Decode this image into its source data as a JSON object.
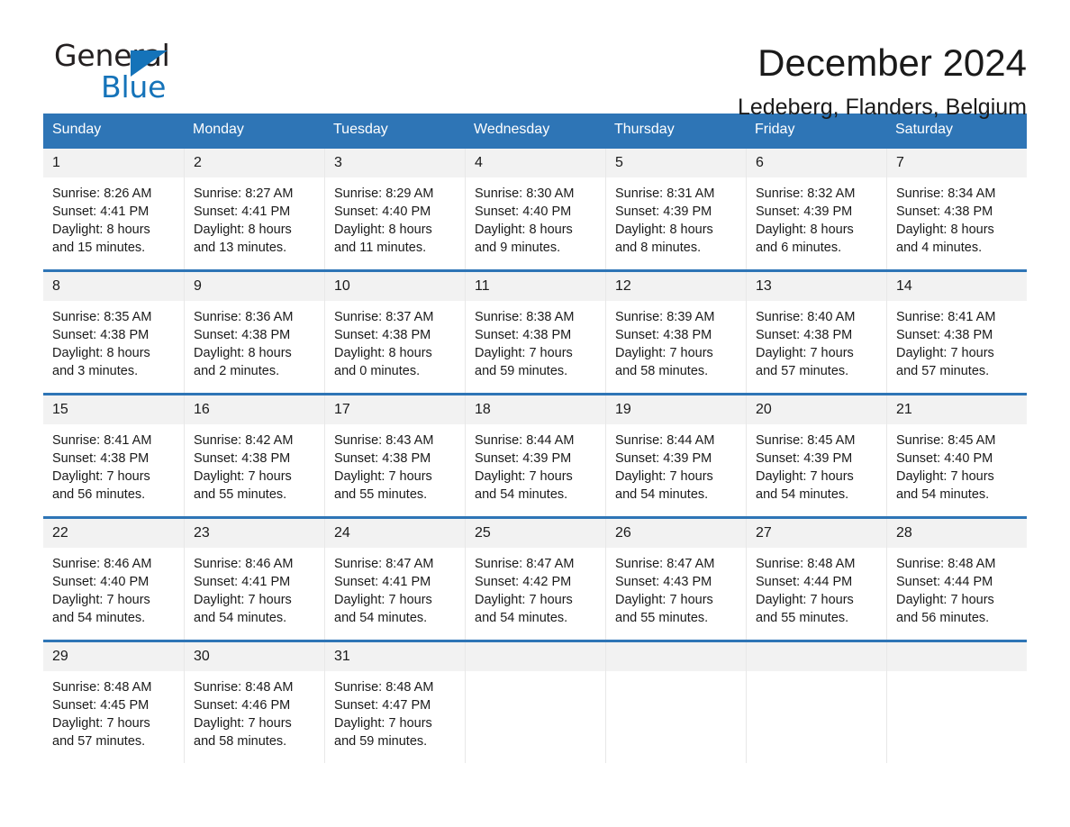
{
  "brand": {
    "name_top": "General",
    "name_bottom": "Blue",
    "accent_color": "#1573b9",
    "triangle_icon": "triangle-icon"
  },
  "header": {
    "title": "December 2024",
    "subtitle": "Ledeberg, Flanders, Belgium",
    "header_bg_color": "#2e75b6",
    "daynum_bg_color": "#f2f2f2"
  },
  "calendar": {
    "weekdays": [
      "Sunday",
      "Monday",
      "Tuesday",
      "Wednesday",
      "Thursday",
      "Friday",
      "Saturday"
    ],
    "weeks": [
      [
        {
          "day": "1",
          "sunrise": "Sunrise: 8:26 AM",
          "sunset": "Sunset: 4:41 PM",
          "daylight1": "Daylight: 8 hours",
          "daylight2": "and 15 minutes."
        },
        {
          "day": "2",
          "sunrise": "Sunrise: 8:27 AM",
          "sunset": "Sunset: 4:41 PM",
          "daylight1": "Daylight: 8 hours",
          "daylight2": "and 13 minutes."
        },
        {
          "day": "3",
          "sunrise": "Sunrise: 8:29 AM",
          "sunset": "Sunset: 4:40 PM",
          "daylight1": "Daylight: 8 hours",
          "daylight2": "and 11 minutes."
        },
        {
          "day": "4",
          "sunrise": "Sunrise: 8:30 AM",
          "sunset": "Sunset: 4:40 PM",
          "daylight1": "Daylight: 8 hours",
          "daylight2": "and 9 minutes."
        },
        {
          "day": "5",
          "sunrise": "Sunrise: 8:31 AM",
          "sunset": "Sunset: 4:39 PM",
          "daylight1": "Daylight: 8 hours",
          "daylight2": "and 8 minutes."
        },
        {
          "day": "6",
          "sunrise": "Sunrise: 8:32 AM",
          "sunset": "Sunset: 4:39 PM",
          "daylight1": "Daylight: 8 hours",
          "daylight2": "and 6 minutes."
        },
        {
          "day": "7",
          "sunrise": "Sunrise: 8:34 AM",
          "sunset": "Sunset: 4:38 PM",
          "daylight1": "Daylight: 8 hours",
          "daylight2": "and 4 minutes."
        }
      ],
      [
        {
          "day": "8",
          "sunrise": "Sunrise: 8:35 AM",
          "sunset": "Sunset: 4:38 PM",
          "daylight1": "Daylight: 8 hours",
          "daylight2": "and 3 minutes."
        },
        {
          "day": "9",
          "sunrise": "Sunrise: 8:36 AM",
          "sunset": "Sunset: 4:38 PM",
          "daylight1": "Daylight: 8 hours",
          "daylight2": "and 2 minutes."
        },
        {
          "day": "10",
          "sunrise": "Sunrise: 8:37 AM",
          "sunset": "Sunset: 4:38 PM",
          "daylight1": "Daylight: 8 hours",
          "daylight2": "and 0 minutes."
        },
        {
          "day": "11",
          "sunrise": "Sunrise: 8:38 AM",
          "sunset": "Sunset: 4:38 PM",
          "daylight1": "Daylight: 7 hours",
          "daylight2": "and 59 minutes."
        },
        {
          "day": "12",
          "sunrise": "Sunrise: 8:39 AM",
          "sunset": "Sunset: 4:38 PM",
          "daylight1": "Daylight: 7 hours",
          "daylight2": "and 58 minutes."
        },
        {
          "day": "13",
          "sunrise": "Sunrise: 8:40 AM",
          "sunset": "Sunset: 4:38 PM",
          "daylight1": "Daylight: 7 hours",
          "daylight2": "and 57 minutes."
        },
        {
          "day": "14",
          "sunrise": "Sunrise: 8:41 AM",
          "sunset": "Sunset: 4:38 PM",
          "daylight1": "Daylight: 7 hours",
          "daylight2": "and 57 minutes."
        }
      ],
      [
        {
          "day": "15",
          "sunrise": "Sunrise: 8:41 AM",
          "sunset": "Sunset: 4:38 PM",
          "daylight1": "Daylight: 7 hours",
          "daylight2": "and 56 minutes."
        },
        {
          "day": "16",
          "sunrise": "Sunrise: 8:42 AM",
          "sunset": "Sunset: 4:38 PM",
          "daylight1": "Daylight: 7 hours",
          "daylight2": "and 55 minutes."
        },
        {
          "day": "17",
          "sunrise": "Sunrise: 8:43 AM",
          "sunset": "Sunset: 4:38 PM",
          "daylight1": "Daylight: 7 hours",
          "daylight2": "and 55 minutes."
        },
        {
          "day": "18",
          "sunrise": "Sunrise: 8:44 AM",
          "sunset": "Sunset: 4:39 PM",
          "daylight1": "Daylight: 7 hours",
          "daylight2": "and 54 minutes."
        },
        {
          "day": "19",
          "sunrise": "Sunrise: 8:44 AM",
          "sunset": "Sunset: 4:39 PM",
          "daylight1": "Daylight: 7 hours",
          "daylight2": "and 54 minutes."
        },
        {
          "day": "20",
          "sunrise": "Sunrise: 8:45 AM",
          "sunset": "Sunset: 4:39 PM",
          "daylight1": "Daylight: 7 hours",
          "daylight2": "and 54 minutes."
        },
        {
          "day": "21",
          "sunrise": "Sunrise: 8:45 AM",
          "sunset": "Sunset: 4:40 PM",
          "daylight1": "Daylight: 7 hours",
          "daylight2": "and 54 minutes."
        }
      ],
      [
        {
          "day": "22",
          "sunrise": "Sunrise: 8:46 AM",
          "sunset": "Sunset: 4:40 PM",
          "daylight1": "Daylight: 7 hours",
          "daylight2": "and 54 minutes."
        },
        {
          "day": "23",
          "sunrise": "Sunrise: 8:46 AM",
          "sunset": "Sunset: 4:41 PM",
          "daylight1": "Daylight: 7 hours",
          "daylight2": "and 54 minutes."
        },
        {
          "day": "24",
          "sunrise": "Sunrise: 8:47 AM",
          "sunset": "Sunset: 4:41 PM",
          "daylight1": "Daylight: 7 hours",
          "daylight2": "and 54 minutes."
        },
        {
          "day": "25",
          "sunrise": "Sunrise: 8:47 AM",
          "sunset": "Sunset: 4:42 PM",
          "daylight1": "Daylight: 7 hours",
          "daylight2": "and 54 minutes."
        },
        {
          "day": "26",
          "sunrise": "Sunrise: 8:47 AM",
          "sunset": "Sunset: 4:43 PM",
          "daylight1": "Daylight: 7 hours",
          "daylight2": "and 55 minutes."
        },
        {
          "day": "27",
          "sunrise": "Sunrise: 8:48 AM",
          "sunset": "Sunset: 4:44 PM",
          "daylight1": "Daylight: 7 hours",
          "daylight2": "and 55 minutes."
        },
        {
          "day": "28",
          "sunrise": "Sunrise: 8:48 AM",
          "sunset": "Sunset: 4:44 PM",
          "daylight1": "Daylight: 7 hours",
          "daylight2": "and 56 minutes."
        }
      ],
      [
        {
          "day": "29",
          "sunrise": "Sunrise: 8:48 AM",
          "sunset": "Sunset: 4:45 PM",
          "daylight1": "Daylight: 7 hours",
          "daylight2": "and 57 minutes."
        },
        {
          "day": "30",
          "sunrise": "Sunrise: 8:48 AM",
          "sunset": "Sunset: 4:46 PM",
          "daylight1": "Daylight: 7 hours",
          "daylight2": "and 58 minutes."
        },
        {
          "day": "31",
          "sunrise": "Sunrise: 8:48 AM",
          "sunset": "Sunset: 4:47 PM",
          "daylight1": "Daylight: 7 hours",
          "daylight2": "and 59 minutes."
        },
        {
          "day": "",
          "sunrise": "",
          "sunset": "",
          "daylight1": "",
          "daylight2": ""
        },
        {
          "day": "",
          "sunrise": "",
          "sunset": "",
          "daylight1": "",
          "daylight2": ""
        },
        {
          "day": "",
          "sunrise": "",
          "sunset": "",
          "daylight1": "",
          "daylight2": ""
        },
        {
          "day": "",
          "sunrise": "",
          "sunset": "",
          "daylight1": "",
          "daylight2": ""
        }
      ]
    ]
  }
}
